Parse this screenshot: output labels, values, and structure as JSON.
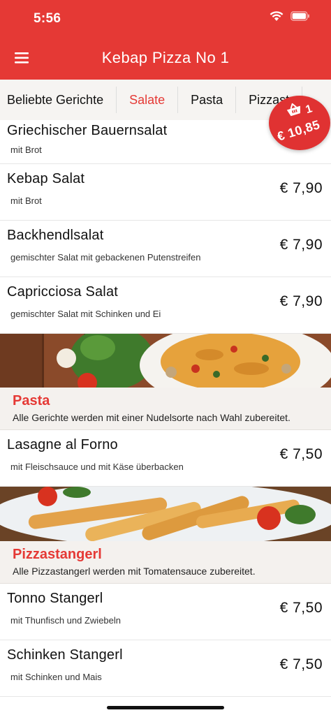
{
  "status": {
    "time": "5:56"
  },
  "header": {
    "title": "Kebap Pizza No 1"
  },
  "tabs": [
    {
      "label": "Beliebte Gerichte"
    },
    {
      "label": "Salate"
    },
    {
      "label": "Pasta"
    },
    {
      "label": "Pizzast"
    }
  ],
  "cart": {
    "count": "1",
    "total": "€ 10,85"
  },
  "salads": [
    {
      "name": "Griechischer Bauernsalat",
      "desc": "mit Brot",
      "price": ""
    },
    {
      "name": "Kebap Salat",
      "desc": "mit Brot",
      "price": "€ 7,90"
    },
    {
      "name": "Backhendlsalat",
      "desc": "gemischter Salat mit gebackenen Putenstreifen",
      "price": "€ 7,90"
    },
    {
      "name": "Capricciosa Salat",
      "desc": "gemischter Salat mit Schinken und Ei",
      "price": "€ 7,90"
    }
  ],
  "pasta": {
    "title": "Pasta",
    "desc": "Alle Gerichte werden mit einer Nudelsorte nach Wahl zubereitet.",
    "items": [
      {
        "name": "Lasagne al Forno",
        "desc": "mit Fleischsauce und mit Käse überbacken",
        "price": "€ 7,50"
      }
    ]
  },
  "stangerl": {
    "title": "Pizzastangerl",
    "desc": "Alle Pizzastangerl werden mit Tomatensauce zubereitet.",
    "items": [
      {
        "name": "Tonno Stangerl",
        "desc": "mit Thunfisch und Zwiebeln",
        "price": "€ 7,50"
      },
      {
        "name": "Schinken Stangerl",
        "desc": "mit Schinken und Mais",
        "price": "€ 7,50"
      }
    ]
  },
  "colors": {
    "brand": "#e53935",
    "badge": "#e03232"
  },
  "icons": [
    "menu-icon",
    "wifi-icon",
    "battery-icon",
    "cart-basket-icon"
  ]
}
